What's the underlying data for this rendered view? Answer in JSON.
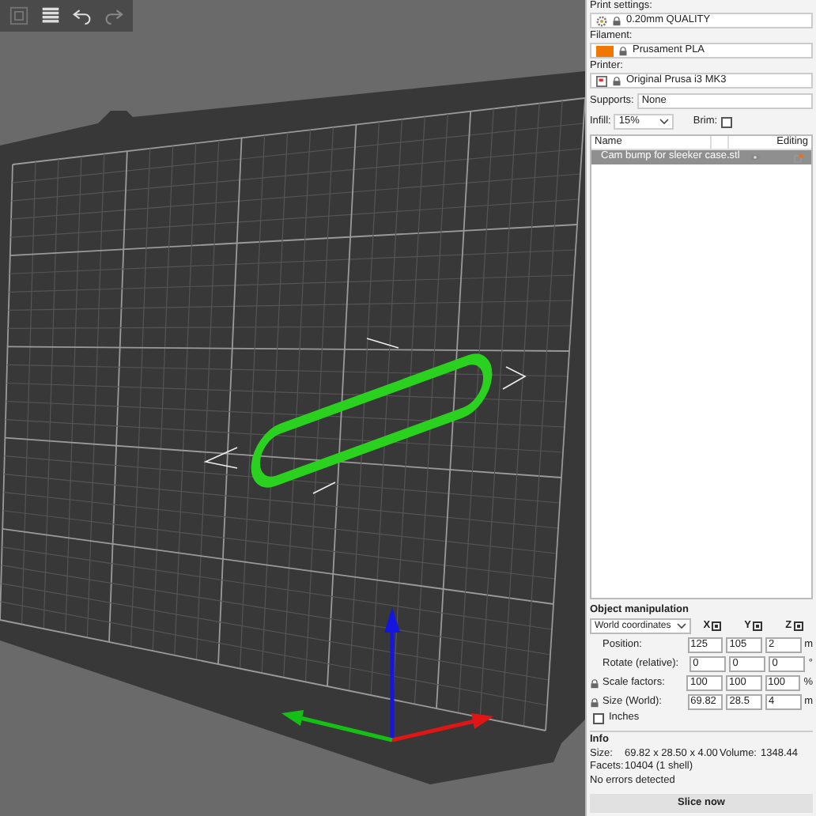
{
  "sidebar": {
    "presets": [
      {
        "kind": "print",
        "label": "Print settings:",
        "value": "0.20mm QUALITY"
      },
      {
        "kind": "filament",
        "label": "Filament:",
        "value": "Prusament PLA",
        "color": "#f07800"
      },
      {
        "kind": "printer",
        "label": "Printer:",
        "value": "Original Prusa i3 MK3"
      }
    ],
    "supports": {
      "label": "Supports:",
      "value": "None"
    },
    "infill": {
      "label": "Infill:",
      "value": "15%"
    },
    "brim": {
      "label": "Brim:",
      "checked": false
    },
    "object_list": {
      "columns": [
        "Name",
        "Editing"
      ],
      "rows": [
        {
          "name": "Cam bump for sleeker case.stl",
          "selected": true
        }
      ]
    },
    "object_manipulation": {
      "title": "Object manipulation",
      "coordinates": "World coordinates",
      "axes": [
        "X",
        "Y",
        "Z"
      ],
      "rows": [
        {
          "label": "Position:",
          "values": [
            "125",
            "105",
            "2"
          ],
          "unit": "m",
          "locked": false
        },
        {
          "label": "Rotate (relative):",
          "values": [
            "0",
            "0",
            "0"
          ],
          "unit": "°",
          "locked": false
        },
        {
          "label": "Scale factors:",
          "values": [
            "100",
            "100",
            "100"
          ],
          "unit": "%",
          "locked": true
        },
        {
          "label": "Size (World):",
          "values": [
            "69.82",
            "28.5",
            "4"
          ],
          "unit": "m",
          "locked": true
        }
      ],
      "inches": {
        "label": "Inches",
        "checked": false
      }
    },
    "info": {
      "title": "Info",
      "size_label": "Size:",
      "size": "69.82 x 28.50 x 4.00",
      "volume_label": "Volume:",
      "volume": "1348.44",
      "facets_label": "Facets:",
      "facets": "10404 (1 shell)",
      "status": "No errors detected"
    },
    "slice_button": "Slice now"
  }
}
